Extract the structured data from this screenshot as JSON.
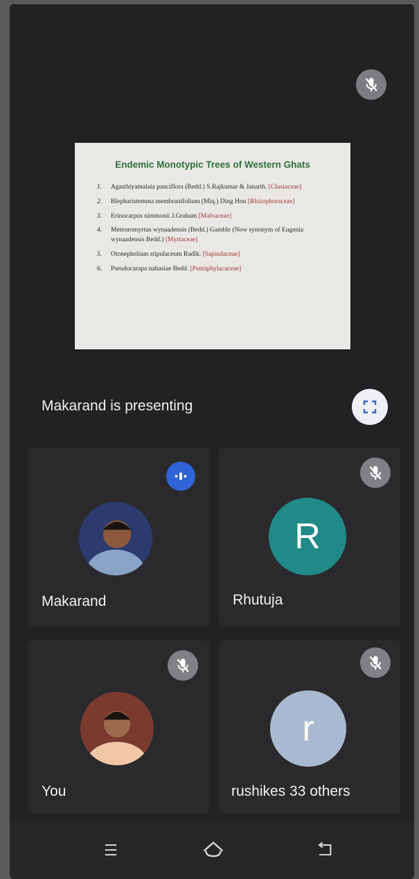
{
  "slide": {
    "title": "Endemic Monotypic Trees of Western Ghats",
    "items": [
      {
        "num": "1.",
        "text": "Agasthiyamalaia pauciflora (Bedd.) S.Rajkumar & Janarth.",
        "family": "[Clusiaceae]"
      },
      {
        "num": "2.",
        "text": "Blepharistemma membranifolium (Miq.) Ding Hou",
        "family": "[Rhizophoraceae]"
      },
      {
        "num": "3.",
        "text": "Erinocarpus nimmonii J.Graham",
        "family": "[Malvaceae]"
      },
      {
        "num": "4.",
        "text": "Meteoromyrtus wynaadensis (Bedd.) Gamble (Now synonym of Eugenia wynaadensis Bedd.)",
        "family": "[Myrtaceae]"
      },
      {
        "num": "5.",
        "text": "Otonephelium stipulaceum Radlk.",
        "family": "[Sapindaceae]"
      },
      {
        "num": "6.",
        "text": "Pseudocarapa nahasiae Bedd.",
        "family": "[Pentaphylacaceae]"
      }
    ]
  },
  "presenting_label": "Makarand is presenting",
  "participants": [
    {
      "name": "Makarand",
      "avatar_type": "photo",
      "status": "speaking"
    },
    {
      "name": "Rhutuja",
      "avatar_type": "letter",
      "letter": "R",
      "avatar_color": "#1f8a87",
      "status": "muted"
    },
    {
      "name": "You",
      "avatar_type": "photo",
      "status": "muted"
    },
    {
      "name": "rushikes  33 others",
      "avatar_type": "letter",
      "letter": "r",
      "avatar_color": "#a9bad0",
      "status": "muted"
    }
  ],
  "icons": {
    "mic_muted": "mic-off-icon",
    "fullscreen": "fullscreen-icon",
    "speaking": "audio-level-icon",
    "nav_recents": "recents-icon",
    "nav_home": "home-icon",
    "nav_back": "back-icon"
  },
  "colors": {
    "background": "#222224",
    "tile": "#2a2a2d",
    "accent_blue": "#2f63d6",
    "slide_title": "#2f6e3c",
    "slide_family": "#a0343a"
  }
}
